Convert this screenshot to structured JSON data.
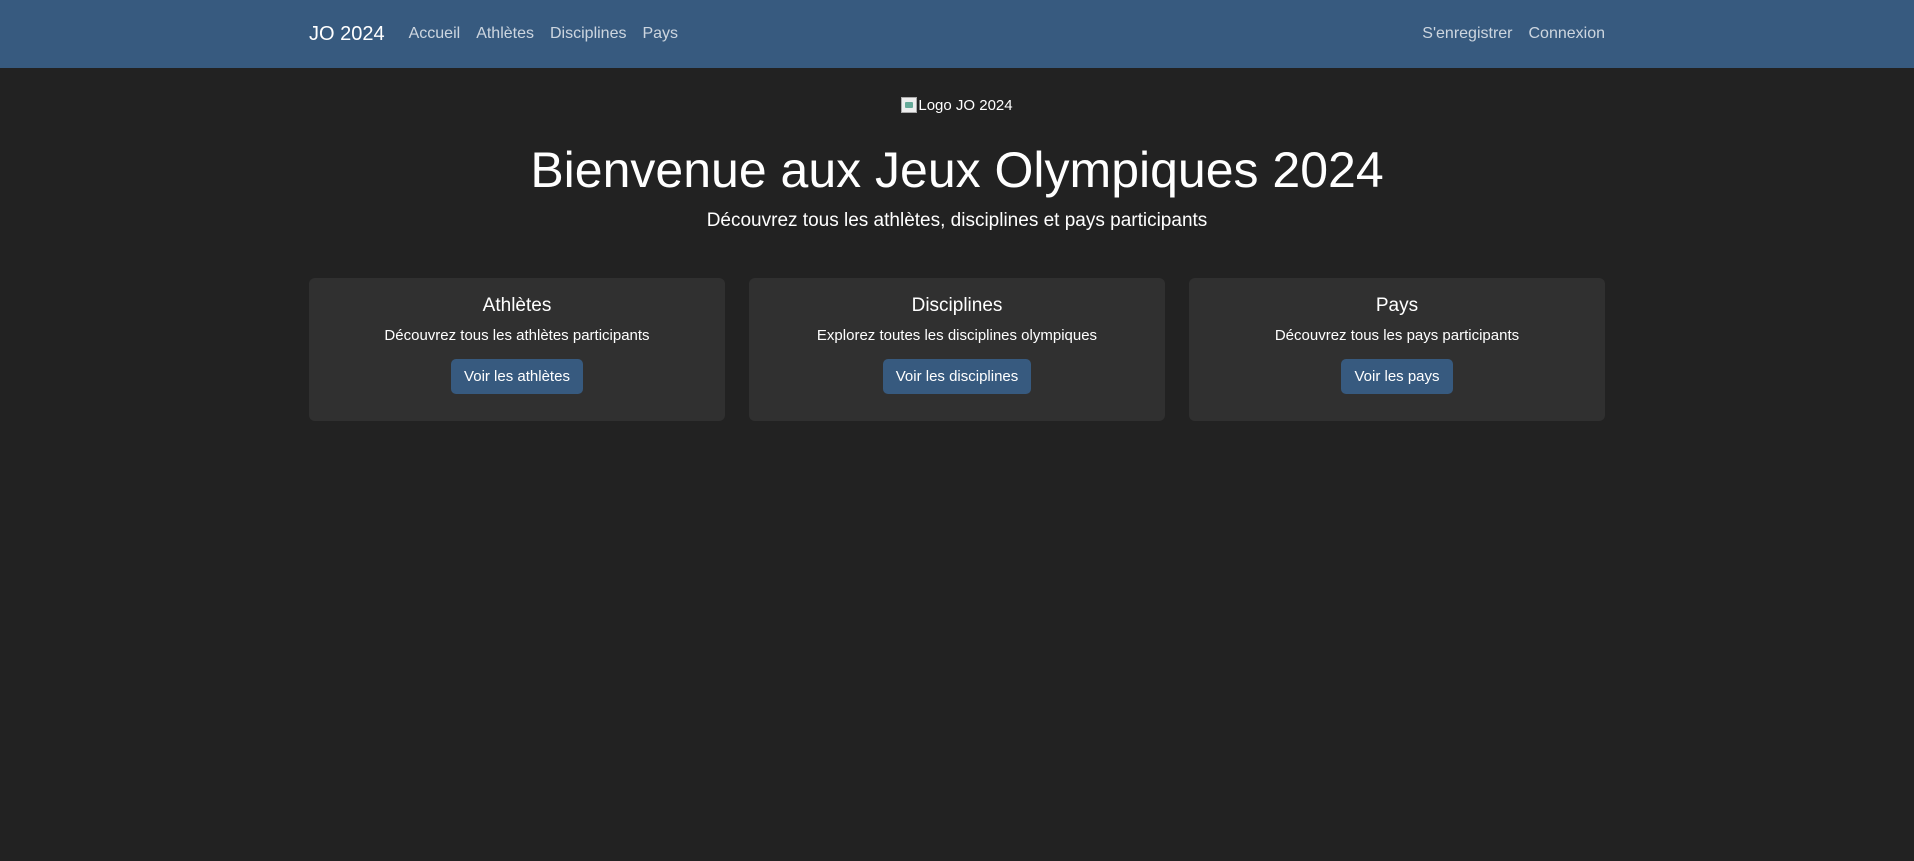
{
  "navbar": {
    "brand": "JO 2024",
    "links": [
      "Accueil",
      "Athlètes",
      "Disciplines",
      "Pays"
    ],
    "auth_links": [
      "S'enregistrer",
      "Connexion"
    ]
  },
  "hero": {
    "logo_alt": "Logo JO 2024",
    "title": "Bienvenue aux Jeux Olympiques 2024",
    "subtitle": "Découvrez tous les athlètes, disciplines et pays participants"
  },
  "cards": [
    {
      "title": "Athlètes",
      "text": "Découvrez tous les athlètes participants",
      "button": "Voir les athlètes"
    },
    {
      "title": "Disciplines",
      "text": "Explorez toutes les disciplines olympiques",
      "button": "Voir les disciplines"
    },
    {
      "title": "Pays",
      "text": "Découvrez tous les pays participants",
      "button": "Voir les pays"
    }
  ],
  "colors": {
    "navbar_bg": "#375a7f",
    "page_bg": "#222222",
    "card_bg": "#303030",
    "button_bg": "#375a7f"
  }
}
